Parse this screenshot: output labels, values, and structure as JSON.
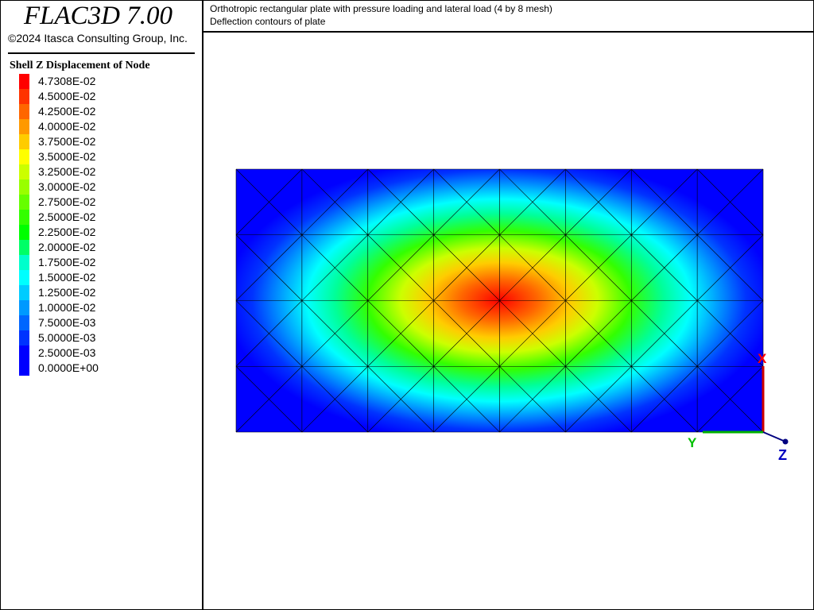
{
  "app": {
    "title": "FLAC3D 7.00",
    "copyright": "©2024 Itasca Consulting Group, Inc."
  },
  "header": {
    "line1": "Orthotropic rectangular plate with pressure loading and lateral load (4 by 8 mesh)",
    "line2": "Deflection contours of plate"
  },
  "legend": {
    "title": "Shell Z Displacement of Node",
    "items": [
      {
        "label": "4.7308E-02",
        "color": "#ff0000"
      },
      {
        "label": "4.5000E-02",
        "color": "#ff3300"
      },
      {
        "label": "4.2500E-02",
        "color": "#ff6600"
      },
      {
        "label": "4.0000E-02",
        "color": "#ff9900"
      },
      {
        "label": "3.7500E-02",
        "color": "#ffcc00"
      },
      {
        "label": "3.5000E-02",
        "color": "#ffff00"
      },
      {
        "label": "3.2500E-02",
        "color": "#ccff00"
      },
      {
        "label": "3.0000E-02",
        "color": "#99ff00"
      },
      {
        "label": "2.7500E-02",
        "color": "#66ff00"
      },
      {
        "label": "2.5000E-02",
        "color": "#33ff00"
      },
      {
        "label": "2.2500E-02",
        "color": "#00ff00"
      },
      {
        "label": "2.0000E-02",
        "color": "#00ff66"
      },
      {
        "label": "1.7500E-02",
        "color": "#00ffcc"
      },
      {
        "label": "1.5000E-02",
        "color": "#00ffff"
      },
      {
        "label": "1.2500E-02",
        "color": "#00ccff"
      },
      {
        "label": "1.0000E-02",
        "color": "#0099ff"
      },
      {
        "label": "7.5000E-03",
        "color": "#0066ff"
      },
      {
        "label": "5.0000E-03",
        "color": "#0033ff"
      },
      {
        "label": "2.5000E-03",
        "color": "#0000ff"
      },
      {
        "label": "0.0000E+00",
        "color": "#0000ff"
      }
    ]
  },
  "axes": {
    "x_label": "X",
    "y_label": "Y",
    "z_label": "Z",
    "x_color": "#ff0000",
    "y_color": "#00c000",
    "z_color": "#0000c0"
  },
  "mesh": {
    "divisions_long": 8,
    "divisions_short": 4
  }
}
